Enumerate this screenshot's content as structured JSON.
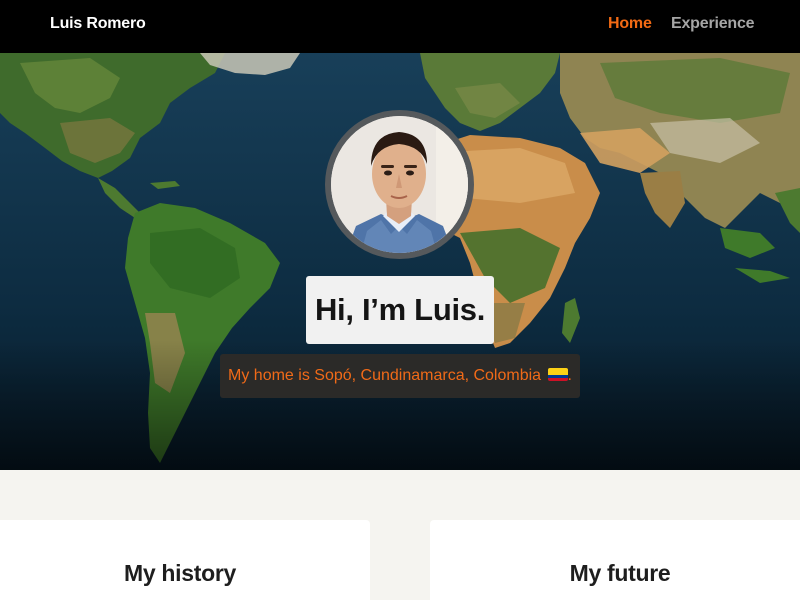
{
  "nav": {
    "brand": "Luis Romero",
    "links": [
      {
        "label": "Home",
        "active": true
      },
      {
        "label": "Experience",
        "active": false
      }
    ],
    "active_color": "#f26a14",
    "inactive_color": "#a6a6a6"
  },
  "hero": {
    "background": "world-map-image",
    "avatar": "profile-photo",
    "greeting": "Hi, I’m Luis.",
    "home_text": "My home is Sopó, Cundinamarca, Colombia",
    "home_suffix": ".",
    "flag": "colombia-flag-icon",
    "accent_color": "#f06a18"
  },
  "sections": [
    {
      "title": "My history"
    },
    {
      "title": "My future"
    }
  ]
}
